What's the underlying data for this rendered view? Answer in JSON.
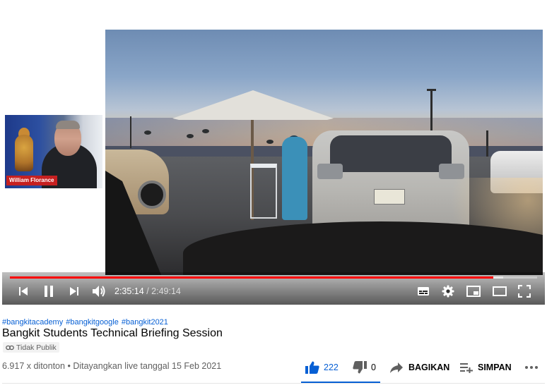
{
  "speaker": {
    "name": "William Florance"
  },
  "player": {
    "current_time": "2:35:14",
    "time_separator": "/",
    "duration": "2:49:14",
    "progress_played": 0.917,
    "progress_loaded": 0.935,
    "colors": {
      "progress": "#ff0000"
    }
  },
  "video": {
    "hashtags": [
      "#bangkitacademy",
      "#bangkitgoogle",
      "#bangkit2021"
    ],
    "title": "Bangkit Students Technical Briefing Session",
    "privacy": "Tidak Publik",
    "views": "6.917 x ditonton",
    "meta_separator": "•",
    "premiere": "Ditayangkan live tanggal 15 Feb 2021"
  },
  "actions": {
    "like_count": "222",
    "dislike_count": "0",
    "share_label": "BAGIKAN",
    "save_label": "SIMPAN",
    "accent": "#065fd4"
  }
}
